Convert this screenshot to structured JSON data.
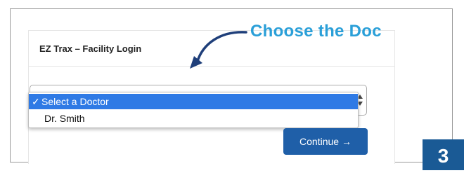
{
  "panel": {
    "title": "EZ Trax – Facility Login"
  },
  "doctor_select": {
    "options": [
      {
        "label": "Select a Doctor",
        "selected": true
      },
      {
        "label": "Dr. Smith",
        "selected": false
      }
    ],
    "check_glyph": "✓"
  },
  "actions": {
    "continue_label": "Continue →"
  },
  "annotation": {
    "text": "Choose the Doc"
  },
  "step": {
    "number": "3"
  },
  "colors": {
    "annotation": "#2a9fd8",
    "button": "#1f5fa8",
    "selection": "#2f7ae5",
    "badge": "#1a5a95"
  },
  "icons": {
    "annotation_arrow": "curved-arrow-icon",
    "select_arrows": "select-updown-icon",
    "check": "checkmark-icon"
  }
}
